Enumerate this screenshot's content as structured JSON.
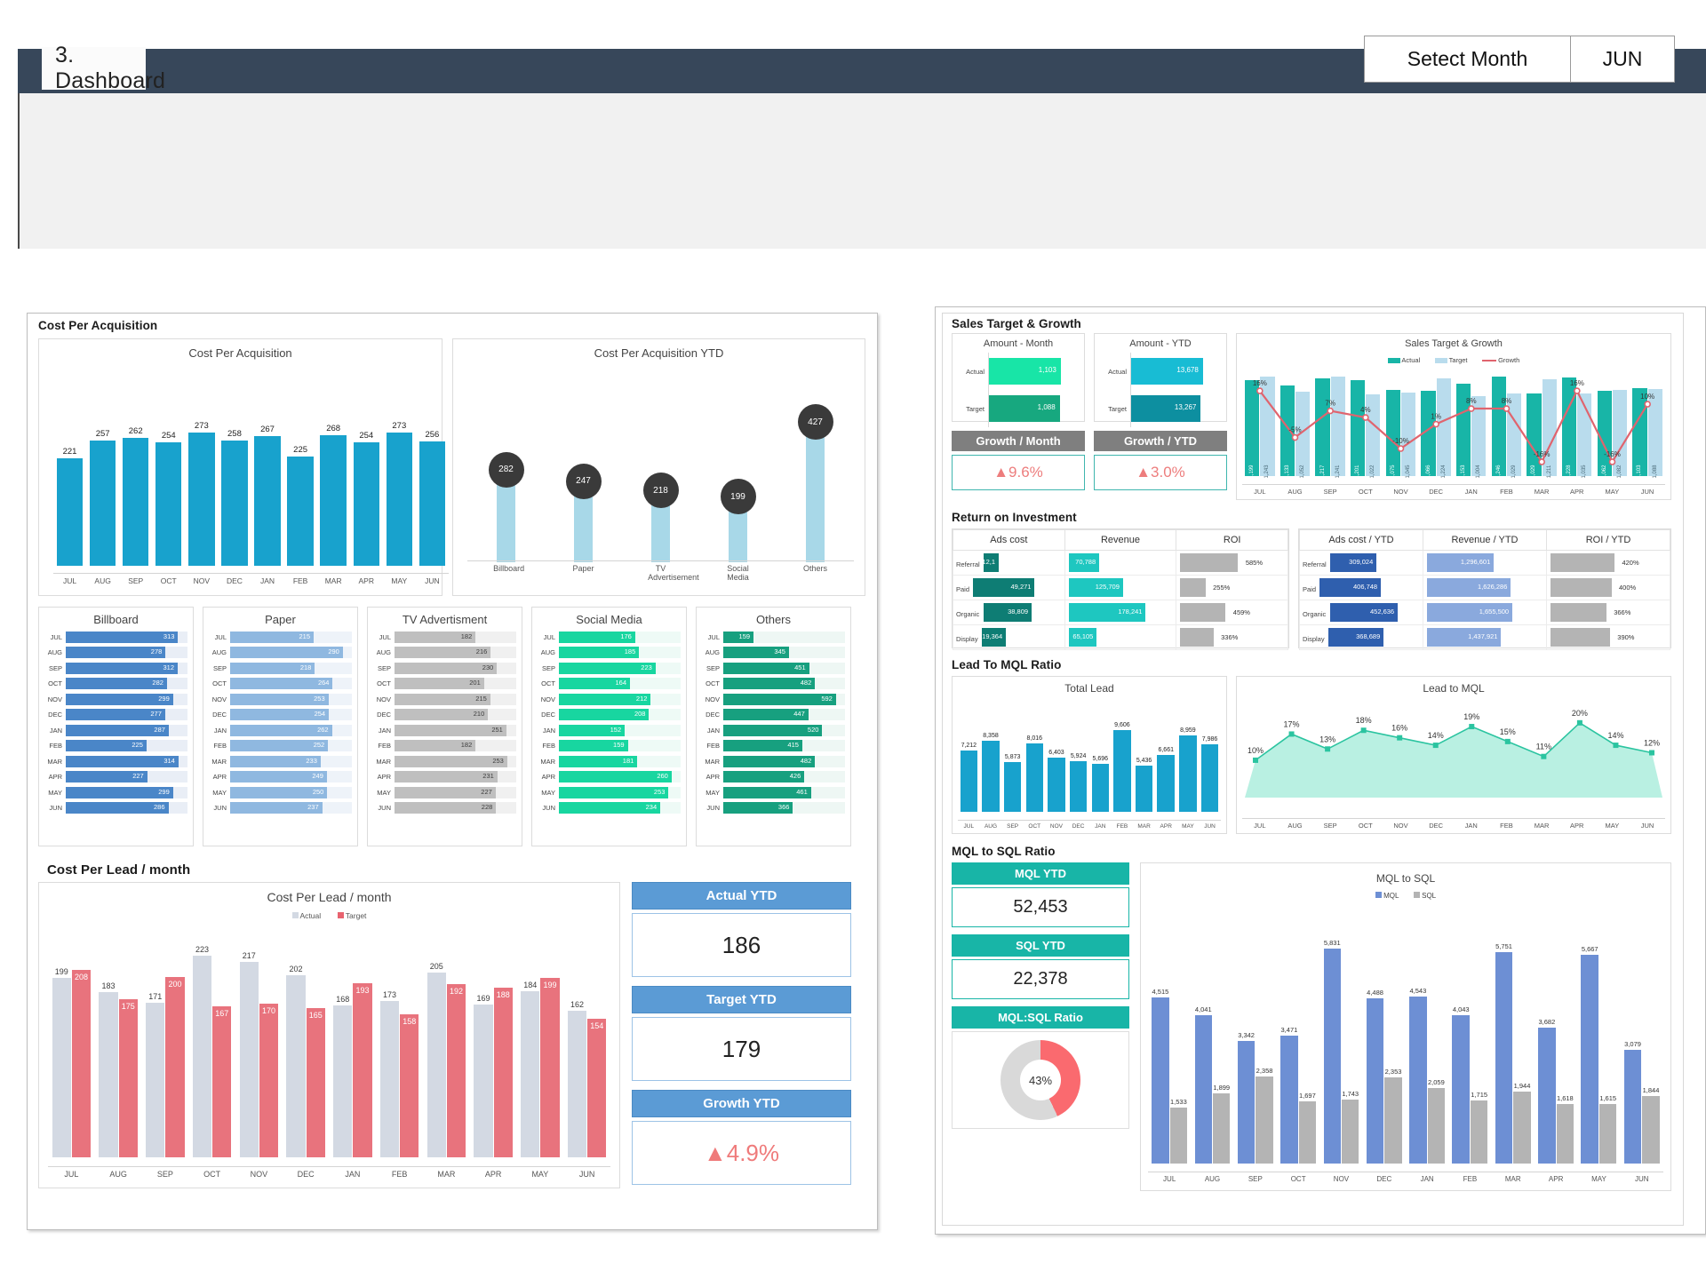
{
  "header": {
    "page_title": "3. Dashboard",
    "month_selector_label": "Setect Month",
    "month_selector_value": "JUN"
  },
  "months": [
    "JUL",
    "AUG",
    "SEP",
    "OCT",
    "NOV",
    "DEC",
    "JAN",
    "FEB",
    "MAR",
    "APR",
    "MAY",
    "JUN"
  ],
  "sections": {
    "cost_per_acquisition": "Cost Per Acquisition",
    "cost_per_lead": "Cost Per Lead / month",
    "sales_target_growth": "Sales Target & Growth",
    "return_on_investment": "Return on Investment",
    "lead_to_mql": "Lead To MQL Ratio",
    "mql_to_sql": "MQL to SQL Ratio"
  },
  "colors": {
    "cyan": "#18a2cd",
    "light_blue": "#a8d8e8",
    "dark_bubble": "#3a3a3a",
    "blue": "#4a86c8",
    "teal": "#18b5a7",
    "green_dark": "#17a07f",
    "gray": "#b4b4b4",
    "red": "#e8636f",
    "accent_blue": "#5b9bd5"
  },
  "chart_data": [
    {
      "type": "bar",
      "title": "Cost Per Acquisition",
      "categories": [
        "JUL",
        "AUG",
        "SEP",
        "OCT",
        "NOV",
        "DEC",
        "JAN",
        "FEB",
        "MAR",
        "APR",
        "MAY",
        "JUN"
      ],
      "values": [
        221,
        257,
        262,
        254,
        273,
        258,
        267,
        225,
        268,
        254,
        273,
        256
      ],
      "xlabel": "",
      "ylabel": "",
      "ylim": [
        0,
        300
      ],
      "grid": false,
      "legend": "none"
    },
    {
      "type": "bar",
      "title": "Cost Per Acquisition YTD",
      "categories": [
        "Billboard",
        "Paper",
        "TV Advertisement",
        "Social Media",
        "Others"
      ],
      "values": [
        282,
        247,
        218,
        199,
        427
      ],
      "xlabel": "",
      "ylabel": "",
      "ylim": [
        0,
        450
      ],
      "grid": false,
      "legend": "none"
    },
    {
      "type": "bar",
      "title": "Billboard",
      "categories": [
        "JUL",
        "AUG",
        "SEP",
        "OCT",
        "NOV",
        "DEC",
        "JAN",
        "FEB",
        "MAR",
        "APR",
        "MAY",
        "JUN"
      ],
      "values": [
        313,
        278,
        312,
        282,
        299,
        277,
        287,
        225,
        314,
        227,
        299,
        286
      ]
    },
    {
      "type": "bar",
      "title": "Paper",
      "categories": [
        "JUL",
        "AUG",
        "SEP",
        "OCT",
        "NOV",
        "DEC",
        "JAN",
        "FEB",
        "MAR",
        "APR",
        "MAY",
        "JUN"
      ],
      "values": [
        215,
        290,
        218,
        264,
        253,
        254,
        262,
        252,
        233,
        249,
        250,
        237
      ]
    },
    {
      "type": "bar",
      "title": "TV Advertisment",
      "categories": [
        "JUL",
        "AUG",
        "SEP",
        "OCT",
        "NOV",
        "DEC",
        "JAN",
        "FEB",
        "MAR",
        "APR",
        "MAY",
        "JUN"
      ],
      "values": [
        182,
        216,
        230,
        201,
        215,
        210,
        251,
        182,
        253,
        231,
        227,
        228
      ]
    },
    {
      "type": "bar",
      "title": "Social Media",
      "categories": [
        "JUL",
        "AUG",
        "SEP",
        "OCT",
        "NOV",
        "DEC",
        "JAN",
        "FEB",
        "MAR",
        "APR",
        "MAY",
        "JUN"
      ],
      "values": [
        176,
        185,
        223,
        164,
        212,
        208,
        152,
        159,
        181,
        260,
        253,
        234
      ]
    },
    {
      "type": "bar",
      "title": "Others",
      "categories": [
        "JUL",
        "AUG",
        "SEP",
        "OCT",
        "NOV",
        "DEC",
        "JAN",
        "FEB",
        "MAR",
        "APR",
        "MAY",
        "JUN"
      ],
      "values": [
        159,
        345,
        451,
        482,
        592,
        447,
        520,
        415,
        482,
        426,
        461,
        366
      ]
    },
    {
      "type": "bar",
      "title": "Cost Per Lead / month",
      "categories": [
        "JUL",
        "AUG",
        "SEP",
        "OCT",
        "NOV",
        "DEC",
        "JAN",
        "FEB",
        "MAR",
        "APR",
        "MAY",
        "JUN"
      ],
      "series": [
        {
          "name": "Actual",
          "values": [
            199,
            183,
            171,
            223,
            217,
            202,
            168,
            173,
            205,
            169,
            184,
            162
          ]
        },
        {
          "name": "Target",
          "values": [
            208,
            175,
            200,
            167,
            170,
            165,
            193,
            158,
            192,
            188,
            199,
            154
          ]
        }
      ],
      "legend": "top"
    },
    {
      "type": "bar",
      "title": "Amount - Month",
      "categories": [
        "Actual",
        "Target"
      ],
      "values": [
        1103,
        1088
      ],
      "value_labels": [
        "1,103",
        "1,088"
      ]
    },
    {
      "type": "bar",
      "title": "Amount - YTD",
      "categories": [
        "Actual",
        "Target"
      ],
      "values": [
        13678,
        13267
      ],
      "value_labels": [
        "13,678",
        "13,267"
      ]
    },
    {
      "type": "bar",
      "title": "Sales Target & Growth",
      "categories": [
        "JUL",
        "AUG",
        "SEP",
        "OCT",
        "NOV",
        "DEC",
        "JAN",
        "FEB",
        "MAR",
        "APR",
        "MAY",
        "JUN"
      ],
      "series": [
        {
          "name": "Actual",
          "values": [
            1199,
            1133,
            1217,
            1201,
            1075,
            1066,
            1153,
            1246,
            1029,
            1228,
            1062,
            1103
          ],
          "labels": [
            "1,199",
            "1,133",
            "1,217",
            "1,201",
            "1,075",
            "1,066",
            "1,153",
            "1,246",
            "1,029",
            "1,228",
            "1,062",
            "1,103"
          ]
        },
        {
          "name": "Target",
          "values": [
            1243,
            1052,
            1241,
            1022,
            1045,
            1224,
            1004,
            1029,
            1211,
            1035,
            1082,
            1088
          ],
          "labels": [
            "1,243",
            "1,052",
            "1,241",
            "1,022",
            "1,045",
            "1,224",
            "1,004",
            "1,029",
            "1,211",
            "1,035",
            "1,082",
            "1,088"
          ]
        },
        {
          "name": "Growth",
          "type": "line",
          "values": [
            16,
            -5,
            7,
            4,
            -10,
            1,
            8,
            8,
            -16,
            16,
            -16,
            10
          ],
          "labels": [
            "16%",
            "-5%",
            "7%",
            "4%",
            "-10%",
            "1%",
            "8%",
            "8%",
            "-16%",
            "16%",
            "-16%",
            "10%"
          ]
        }
      ],
      "legend": "top"
    },
    {
      "type": "bar",
      "title": "Total Lead",
      "categories": [
        "JUL",
        "AUG",
        "SEP",
        "OCT",
        "NOV",
        "DEC",
        "JAN",
        "FEB",
        "MAR",
        "APR",
        "MAY",
        "JUN"
      ],
      "values": [
        7212,
        8358,
        5873,
        8016,
        6403,
        5924,
        5696,
        9606,
        5436,
        6661,
        8959,
        7986
      ],
      "value_labels": [
        "7,212",
        "8,358",
        "5,873",
        "8,016",
        "6,403",
        "5,924",
        "5,696",
        "9,606",
        "5,436",
        "6,661",
        "8,959",
        "7,986"
      ]
    },
    {
      "type": "area",
      "title": "Lead to MQL",
      "categories": [
        "JUL",
        "AUG",
        "SEP",
        "OCT",
        "NOV",
        "DEC",
        "JAN",
        "FEB",
        "MAR",
        "APR",
        "MAY",
        "JUN"
      ],
      "values": [
        10,
        17,
        13,
        18,
        16,
        14,
        19,
        15,
        11,
        20,
        14,
        12
      ],
      "value_labels": [
        "10%",
        "17%",
        "13%",
        "18%",
        "16%",
        "14%",
        "19%",
        "15%",
        "11%",
        "20%",
        "14%",
        "12%"
      ],
      "ylim": [
        0,
        22
      ]
    },
    {
      "type": "bar",
      "title": "MQL to SQL",
      "categories": [
        "JUL",
        "AUG",
        "SEP",
        "OCT",
        "NOV",
        "DEC",
        "JAN",
        "FEB",
        "MAR",
        "APR",
        "MAY",
        "JUN"
      ],
      "series": [
        {
          "name": "MQL",
          "values": [
            4515,
            4041,
            3342,
            3471,
            5831,
            4488,
            4543,
            4043,
            5751,
            3682,
            5667,
            3079
          ],
          "labels": [
            "4,515",
            "4,041",
            "3,342",
            "3,471",
            "5,831",
            "4,488",
            "4,543",
            "4,043",
            "5,751",
            "3,682",
            "5,667",
            "3,079"
          ]
        },
        {
          "name": "SQL",
          "values": [
            1533,
            1899,
            2358,
            1697,
            1743,
            2353,
            2059,
            1715,
            1944,
            1618,
            1615,
            1844
          ],
          "labels": [
            "1,533",
            "1,899",
            "2,358",
            "1,697",
            "1,743",
            "2,353",
            "2,059",
            "1,715",
            "1,944",
            "1,618",
            "1,615",
            "1,844"
          ]
        }
      ],
      "legend": "top"
    },
    {
      "type": "pie",
      "title": "MQL:SQL Ratio",
      "categories": [
        "SQL",
        "Remainder"
      ],
      "values": [
        43,
        57
      ],
      "center_label": "43%"
    }
  ],
  "kpi_cards": {
    "actual_ytd": {
      "label": "Actual YTD",
      "value": "186"
    },
    "target_ytd": {
      "label": "Target YTD",
      "value": "179"
    },
    "growth_ytd": {
      "label": "Growth YTD",
      "value": "4.9%",
      "arrow": "▲"
    }
  },
  "growth_cards": {
    "growth_month": {
      "label": "Growth / Month",
      "value": "9.6%",
      "arrow": "▲"
    },
    "growth_ytd": {
      "label": "Growth / YTD",
      "value": "3.0%",
      "arrow": "▲"
    }
  },
  "mql_cards": {
    "mql_ytd": {
      "label": "MQL YTD",
      "value": "52,453"
    },
    "sql_ytd": {
      "label": "SQL YTD",
      "value": "22,378"
    },
    "ratio": {
      "label": "MQL:SQL Ratio",
      "value": "43%"
    }
  },
  "roi_month": {
    "columns": [
      "Ads cost",
      "Revenue",
      "ROI"
    ],
    "rows": [
      {
        "channel": "Referral",
        "ads_cost": "12,1",
        "ads_cost_val": 12100,
        "revenue": "70,788",
        "revenue_val": 70788,
        "roi": "585%",
        "roi_val": 585
      },
      {
        "channel": "Paid",
        "ads_cost": "49,271",
        "ads_cost_val": 49271,
        "revenue": "125,709",
        "revenue_val": 125709,
        "roi": "255%",
        "roi_val": 255
      },
      {
        "channel": "Organic",
        "ads_cost": "38,809",
        "ads_cost_val": 38809,
        "revenue": "178,241",
        "revenue_val": 178241,
        "roi": "459%",
        "roi_val": 459
      },
      {
        "channel": "Display",
        "ads_cost": "19,364",
        "ads_cost_val": 19364,
        "revenue": "65,105",
        "revenue_val": 65105,
        "roi": "336%",
        "roi_val": 336
      }
    ]
  },
  "roi_ytd": {
    "columns": [
      "Ads cost / YTD",
      "Revenue / YTD",
      "ROI / YTD"
    ],
    "rows": [
      {
        "channel": "Referral",
        "ads_cost": "309,024",
        "ads_cost_val": 309024,
        "revenue": "1,296,601",
        "revenue_val": 1296601,
        "roi": "420%",
        "roi_val": 420
      },
      {
        "channel": "Paid",
        "ads_cost": "406,748",
        "ads_cost_val": 406748,
        "revenue": "1,626,286",
        "revenue_val": 1626286,
        "roi": "400%",
        "roi_val": 400
      },
      {
        "channel": "Organic",
        "ads_cost": "452,636",
        "ads_cost_val": 452636,
        "revenue": "1,655,500",
        "revenue_val": 1655500,
        "roi": "366%",
        "roi_val": 366
      },
      {
        "channel": "Display",
        "ads_cost": "368,689",
        "ads_cost_val": 368689,
        "revenue": "1,437,921",
        "revenue_val": 1437921,
        "roi": "390%",
        "roi_val": 390
      }
    ]
  }
}
